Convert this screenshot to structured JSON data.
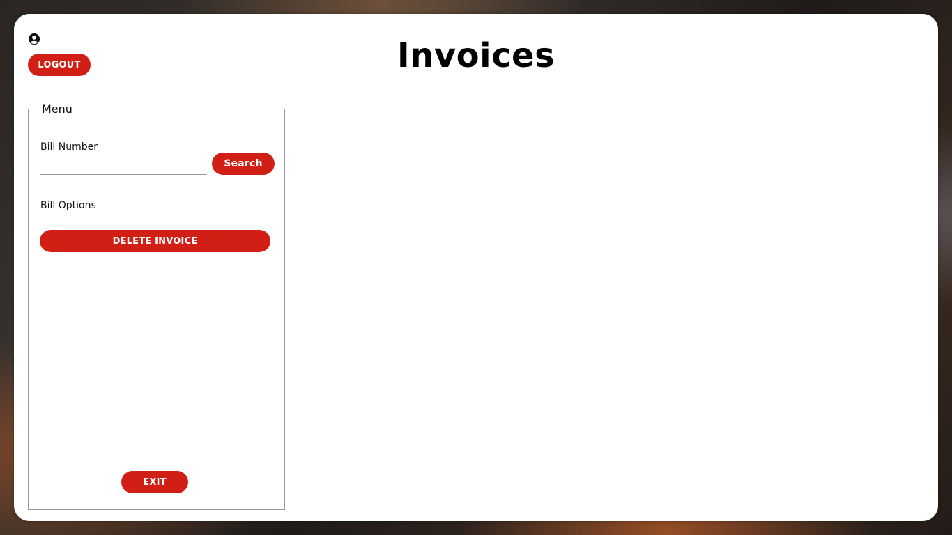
{
  "header": {
    "title": "Invoices",
    "user_icon": "user-circle-icon",
    "logout_label": "LOGOUT"
  },
  "menu": {
    "legend": "Menu",
    "bill_number_label": "Bill Number",
    "bill_number_value": "",
    "bill_number_placeholder": "",
    "search_label": "Search",
    "bill_options_label": "Bill Options",
    "delete_invoice_label": "DELETE INVOICE",
    "exit_label": "EXIT"
  },
  "colors": {
    "accent": "#d11f16",
    "card_background": "#ffffff"
  }
}
